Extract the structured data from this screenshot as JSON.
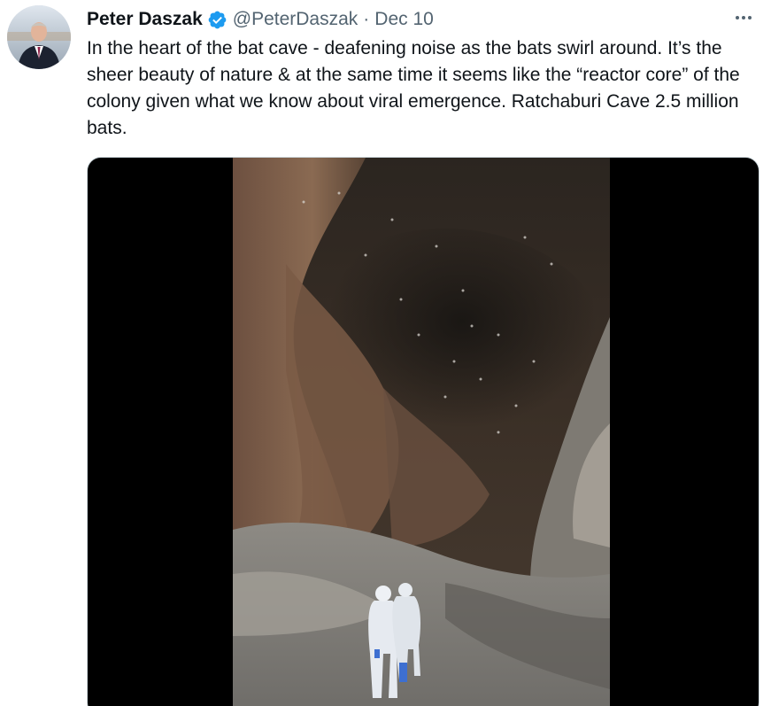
{
  "author": {
    "name": "Peter Daszak",
    "handle": "@PeterDaszak",
    "separator": "·",
    "date": "Dec 10",
    "verified_icon": "verified-badge-icon",
    "verified_color": "#1d9bf0"
  },
  "tweet": {
    "text": "In the heart of the bat cave - deafening noise as the bats swirl around. It’s the sheer beauty of nature & at the same time it seems like the “reactor core” of the colony given what we know about viral emergence. Ratchaburi Cave 2.5 million bats."
  },
  "more_icon": "more-horizontal-icon",
  "media": {
    "type": "video",
    "frame_description_icon": "video-frame"
  },
  "colors": {
    "text": "#0f1419",
    "secondary": "#536471",
    "border": "#cfd9de"
  }
}
